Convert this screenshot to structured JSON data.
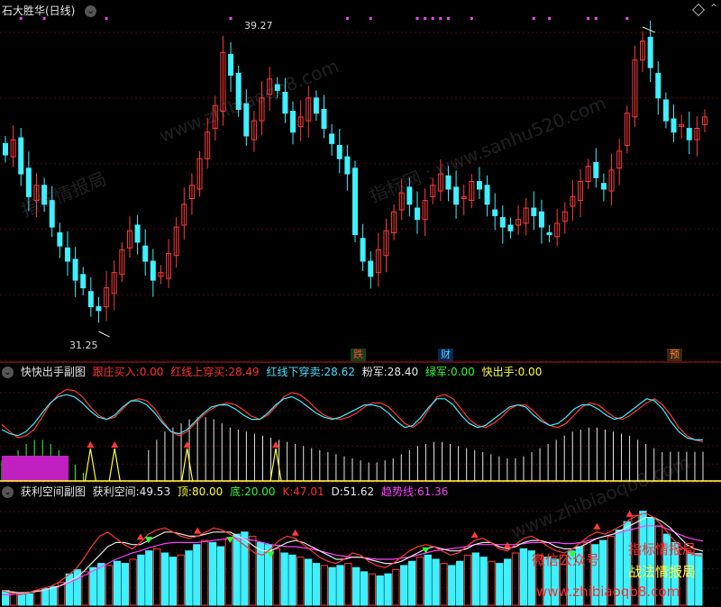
{
  "main": {
    "title": "石大胜华(日线)",
    "high_label": "39.27",
    "low_label": "31.25",
    "bottom_tags": [
      "跌",
      "财",
      "预"
    ]
  },
  "panel1": {
    "title": "快快出手副图",
    "items": [
      {
        "label": "跟庄买入:",
        "value": "0.00",
        "color": "#ff3030"
      },
      {
        "label": "红线上穿买:",
        "value": "28.49",
        "color": "#ff3030"
      },
      {
        "label": "红线下穿卖:",
        "value": "28.62",
        "color": "#40e0ff"
      },
      {
        "label": "粉军:",
        "value": "28.40",
        "color": "#e8e8e8"
      },
      {
        "label": "绿军:",
        "value": "0.00",
        "color": "#30ff30"
      },
      {
        "label": "快出手:",
        "value": "0.00",
        "color": "#ffff40"
      }
    ]
  },
  "panel2": {
    "title": "获利空间副图",
    "items": [
      {
        "label": "获利空间:",
        "value": "49.53",
        "color": "#e8e8e8"
      },
      {
        "label": "顶:",
        "value": "80.00",
        "color": "#ffff40"
      },
      {
        "label": "底:",
        "value": "20.00",
        "color": "#30ff30"
      },
      {
        "label": "K:",
        "value": "47.01",
        "color": "#ff3030"
      },
      {
        "label": "D:",
        "value": "51.62",
        "color": "#e8e8e8"
      },
      {
        "label": "趋势线:",
        "value": "61.36",
        "color": "#ff40ff"
      }
    ]
  },
  "watermarks": {
    "w1": "www.zhibiaoqb8.com",
    "w2": "指标网 : www.sanhu520.com",
    "w3": "指标情报局",
    "w4": "www.zhibiaoqb8.com"
  },
  "sidebar_text": {
    "s1": "微信公众号",
    "s2": "指标情报局",
    "s3": "战法情报局",
    "s4": "www.zhibiaoqb8.com"
  },
  "colors": {
    "up": "#ff3a3a",
    "down": "#3ff0ff",
    "pink": "#ff40ff",
    "yellow": "#ffff40",
    "green": "#30ff30"
  },
  "chart_data": [
    {
      "type": "candlestick",
      "y_range": [
        31.25,
        39.27
      ],
      "annotated_high": 39.27,
      "annotated_low": 31.25,
      "close_series": [
        35.9,
        36.3,
        35.4,
        34.8,
        35.1,
        34.6,
        34.0,
        33.5,
        33.1,
        32.6,
        32.4,
        31.9,
        31.8,
        32.4,
        32.8,
        33.4,
        33.9,
        33.6,
        33.1,
        32.6,
        32.8,
        33.3,
        34.0,
        34.6,
        35.1,
        35.8,
        36.5,
        37.2,
        38.6,
        38.0,
        37.1,
        36.4,
        36.8,
        37.4,
        37.9,
        37.6,
        37.0,
        36.5,
        36.9,
        37.4,
        37.0,
        36.6,
        36.2,
        35.8,
        35.4,
        33.8,
        33.1,
        32.7,
        33.4,
        33.9,
        34.4,
        34.9,
        34.6,
        34.2,
        34.7,
        35.1,
        35.4,
        35.0,
        34.6,
        34.8,
        35.2,
        35.0,
        34.6,
        34.3,
        34.0,
        33.9,
        34.2,
        34.5,
        34.3,
        34.0,
        33.8,
        34.1,
        34.4,
        34.8,
        35.2,
        35.6,
        35.3,
        35.0,
        35.5,
        36.0,
        37.0,
        38.4,
        38.9,
        38.2,
        37.4,
        36.8,
        36.5,
        36.7,
        36.3,
        36.6,
        36.9
      ],
      "purple_markers": true
    },
    {
      "type": "line",
      "name": "快快出手副图",
      "series": [
        {
          "name": "红线",
          "values": [
            55,
            48,
            42,
            44,
            50,
            62,
            75,
            84,
            89,
            88,
            82,
            72,
            64,
            60,
            62,
            70,
            78,
            80,
            78,
            70,
            58,
            48,
            44,
            48,
            56,
            64,
            70,
            74,
            76,
            74,
            69,
            63,
            60,
            64,
            72,
            82,
            86,
            84,
            78,
            70,
            64,
            61,
            60,
            62,
            66,
            72,
            76,
            76,
            72,
            64,
            56,
            52,
            58,
            70,
            82,
            84,
            80,
            70,
            60,
            54,
            52,
            56,
            62,
            70,
            74,
            74,
            68,
            60,
            54,
            52,
            56,
            64,
            72,
            76,
            74,
            68,
            62,
            60,
            64,
            70,
            76,
            80,
            74,
            64,
            52,
            44,
            40,
            38
          ]
        },
        {
          "name": "蓝线",
          "values": [
            50,
            46,
            44,
            48,
            56,
            66,
            76,
            82,
            84,
            82,
            76,
            68,
            62,
            60,
            64,
            72,
            78,
            78,
            74,
            66,
            56,
            48,
            46,
            50,
            58,
            66,
            72,
            74,
            74,
            70,
            64,
            60,
            60,
            66,
            74,
            80,
            82,
            78,
            72,
            66,
            62,
            60,
            62,
            66,
            70,
            74,
            74,
            72,
            66,
            58,
            52,
            54,
            62,
            72,
            80,
            80,
            74,
            64,
            56,
            52,
            54,
            60,
            66,
            72,
            74,
            72,
            64,
            58,
            54,
            56,
            62,
            70,
            74,
            74,
            70,
            64,
            60,
            62,
            68,
            74,
            80,
            78,
            70,
            58,
            48,
            42,
            40,
            40
          ]
        },
        {
          "name": "粉军",
          "values": [
            0,
            0,
            0,
            0,
            0,
            0,
            0,
            0,
            0,
            0,
            0,
            0,
            0,
            0,
            0,
            0,
            0,
            0,
            30,
            40,
            48,
            52,
            56,
            60,
            62,
            62,
            60,
            56,
            52,
            50,
            48,
            46,
            44,
            42,
            40,
            38,
            36,
            34,
            32,
            30,
            28,
            26,
            24,
            22,
            20,
            18,
            18,
            20,
            22,
            26,
            30,
            34,
            36,
            38,
            38,
            36,
            34,
            32,
            30,
            28,
            26,
            24,
            22,
            22,
            24,
            28,
            32,
            36,
            40,
            44,
            48,
            50,
            52,
            52,
            50,
            48,
            46,
            44,
            40,
            36,
            32,
            28,
            28.4,
            28.4,
            28.4,
            28.4,
            28.4
          ]
        },
        {
          "name": "绿军",
          "values": [
            20,
            24,
            30,
            36,
            40,
            40,
            36,
            30,
            24,
            16,
            8,
            0,
            0,
            0,
            0,
            0,
            0,
            0,
            0,
            0,
            0,
            0,
            0,
            0,
            0,
            0,
            0,
            0,
            0,
            0,
            0,
            0,
            0,
            0,
            0,
            0,
            0,
            0,
            0,
            0,
            0,
            0,
            0,
            0,
            0,
            0,
            0,
            0,
            0,
            0,
            0,
            0,
            0,
            0,
            0,
            0,
            0,
            0,
            0,
            0,
            0,
            0,
            0,
            0,
            0,
            0,
            0,
            0,
            0,
            0,
            0,
            0,
            0,
            0,
            0,
            0,
            0,
            0,
            0,
            0,
            0,
            0,
            0,
            0,
            0,
            0,
            0
          ]
        }
      ]
    },
    {
      "type": "bar",
      "name": "获利空间副图",
      "hlines": {
        "顶": 80,
        "底": 20
      },
      "series": [
        {
          "name": "获利空间",
          "values": [
            14,
            12,
            10,
            11,
            14,
            16,
            18,
            22,
            30,
            34,
            32,
            36,
            40,
            38,
            42,
            40,
            44,
            48,
            52,
            54,
            50,
            46,
            48,
            52,
            58,
            62,
            60,
            56,
            64,
            68,
            70,
            66,
            60,
            58,
            54,
            50,
            48,
            46,
            44,
            40,
            38,
            36,
            38,
            40,
            36,
            32,
            30,
            28,
            30,
            34,
            38,
            42,
            46,
            48,
            44,
            40,
            38,
            42,
            48,
            50,
            46,
            42,
            40,
            44,
            50,
            54,
            52,
            48,
            46,
            44,
            48,
            52,
            56,
            60,
            58,
            62,
            66,
            72,
            80,
            86,
            90,
            84,
            76,
            68,
            60,
            54,
            50,
            49.53
          ]
        },
        {
          "name": "K",
          "values": [
            14,
            12,
            10,
            11,
            14,
            16,
            18,
            22,
            28,
            34,
            44,
            56,
            66,
            70,
            64,
            58,
            54,
            60,
            68,
            72,
            74,
            70,
            66,
            64,
            66,
            70,
            74,
            72,
            68,
            62,
            56,
            50,
            48,
            54,
            62,
            66,
            64,
            58,
            52,
            46,
            42,
            40,
            44,
            50,
            48,
            42,
            38,
            36,
            40,
            46,
            52,
            56,
            58,
            56,
            52,
            48,
            50,
            56,
            62,
            64,
            60,
            54,
            52,
            58,
            64,
            66,
            62,
            56,
            52,
            50,
            54,
            60,
            66,
            70,
            68,
            72,
            76,
            82,
            86,
            88,
            84,
            76,
            66,
            58,
            52,
            48,
            47.01
          ]
        },
        {
          "name": "D",
          "values": [
            14,
            13,
            12,
            12,
            13,
            14,
            16,
            18,
            22,
            26,
            32,
            40,
            48,
            56,
            60,
            60,
            58,
            58,
            62,
            66,
            70,
            70,
            68,
            66,
            66,
            68,
            70,
            70,
            70,
            66,
            62,
            56,
            52,
            52,
            56,
            60,
            62,
            60,
            56,
            52,
            48,
            44,
            44,
            46,
            46,
            44,
            42,
            40,
            40,
            42,
            46,
            50,
            54,
            56,
            54,
            52,
            52,
            54,
            58,
            60,
            60,
            56,
            54,
            56,
            60,
            62,
            62,
            60,
            56,
            54,
            54,
            56,
            60,
            64,
            66,
            68,
            72,
            76,
            80,
            84,
            84,
            80,
            74,
            66,
            58,
            54,
            51.62
          ]
        },
        {
          "name": "趋势线",
          "values": [
            10,
            10,
            11,
            12,
            13,
            14,
            16,
            18,
            21,
            24,
            28,
            32,
            36,
            40,
            44,
            47,
            50,
            52,
            55,
            57,
            59,
            60,
            60,
            60,
            60,
            61,
            62,
            63,
            64,
            64,
            63,
            62,
            60,
            58,
            57,
            56,
            56,
            55,
            54,
            52,
            50,
            48,
            47,
            46,
            46,
            45,
            44,
            44,
            44,
            45,
            46,
            48,
            50,
            52,
            53,
            54,
            55,
            56,
            58,
            58,
            58,
            58,
            58,
            58,
            59,
            60,
            60,
            60,
            60,
            59,
            59,
            60,
            62,
            64,
            66,
            68,
            70,
            72,
            74,
            76,
            76,
            75,
            72,
            68,
            65,
            63,
            61.36
          ]
        }
      ]
    }
  ]
}
